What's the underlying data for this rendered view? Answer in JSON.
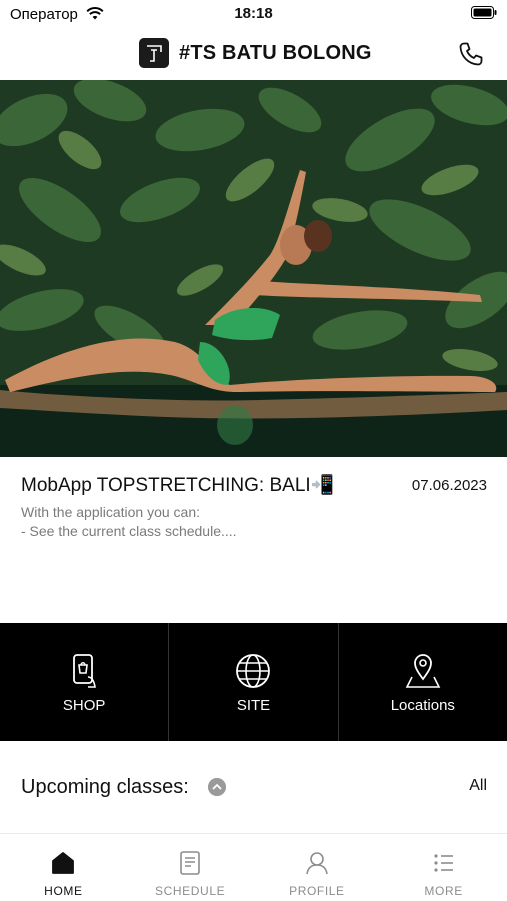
{
  "status_bar": {
    "carrier": "Оператор",
    "time": "18:18"
  },
  "header": {
    "title": "#TS BATU BOLONG",
    "logo_icon": "ts-logo-icon",
    "phone_icon": "phone-icon"
  },
  "news": {
    "title": "MobApp TOPSTRETCHING: BALI📲",
    "date": "07.06.2023",
    "body": "With the application you can:\n- See the current class schedule...."
  },
  "quick_links": [
    {
      "label": "SHOP",
      "icon": "phone-shop-icon"
    },
    {
      "label": "SITE",
      "icon": "globe-icon"
    },
    {
      "label": "Locations",
      "icon": "map-pin-icon"
    }
  ],
  "upcoming": {
    "title": "Upcoming classes:",
    "all_label": "All"
  },
  "tabs": [
    {
      "label": "HOME",
      "icon": "home-icon",
      "active": true
    },
    {
      "label": "SCHEDULE",
      "icon": "schedule-icon",
      "active": false
    },
    {
      "label": "PROFILE",
      "icon": "profile-icon",
      "active": false
    },
    {
      "label": "MORE",
      "icon": "more-list-icon",
      "active": false
    }
  ],
  "colors": {
    "quick_bar_bg": "#000000",
    "active_tab": "#111111",
    "inactive_tab": "#8c8c8c",
    "toggle_bg": "#9a9a9a"
  }
}
